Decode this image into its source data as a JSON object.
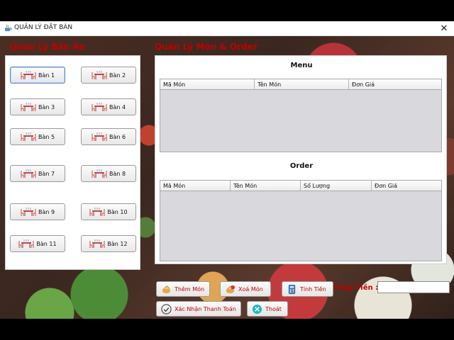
{
  "window": {
    "title": "QUẢN LÝ ĐẶT BÀN",
    "close_symbol": "✕"
  },
  "headings": {
    "tables": "Quản Lý Bàn Ăn",
    "menu_order": "Quản Lý Món & Order"
  },
  "tables": [
    {
      "label": "Bàn 1",
      "active": true
    },
    {
      "label": "Bàn 2"
    },
    {
      "label": "Bàn 3"
    },
    {
      "label": "Bàn 4"
    },
    {
      "label": "Bàn 5"
    },
    {
      "label": "Bàn 6"
    },
    {
      "label": "Bàn 7"
    },
    {
      "label": "Bàn 8"
    },
    {
      "label": "Bàn 9"
    },
    {
      "label": "Bàn 10"
    },
    {
      "label": "Bàn 11"
    },
    {
      "label": "Bàn 12"
    }
  ],
  "menu": {
    "title": "Menu",
    "columns": [
      "Mã Món",
      "Tên Món",
      "Đơn Giá"
    ]
  },
  "order": {
    "title": "Order",
    "columns": [
      "Mã Món",
      "Tên Món",
      "Số Lượng",
      "Đơn Giá"
    ]
  },
  "actions": {
    "add_item": "Thêm Món",
    "delete_item": "Xoá Món",
    "calculate": "Tính Tiền",
    "confirm_payment": "Xác Nhận Thanh Toán",
    "exit": "Thoát"
  },
  "total": {
    "label": "Tổng Tiền :",
    "value": ""
  },
  "colors": {
    "heading": "#c00000",
    "panel_bg": "#ffffff",
    "grid_bg": "#d9d9dd"
  }
}
